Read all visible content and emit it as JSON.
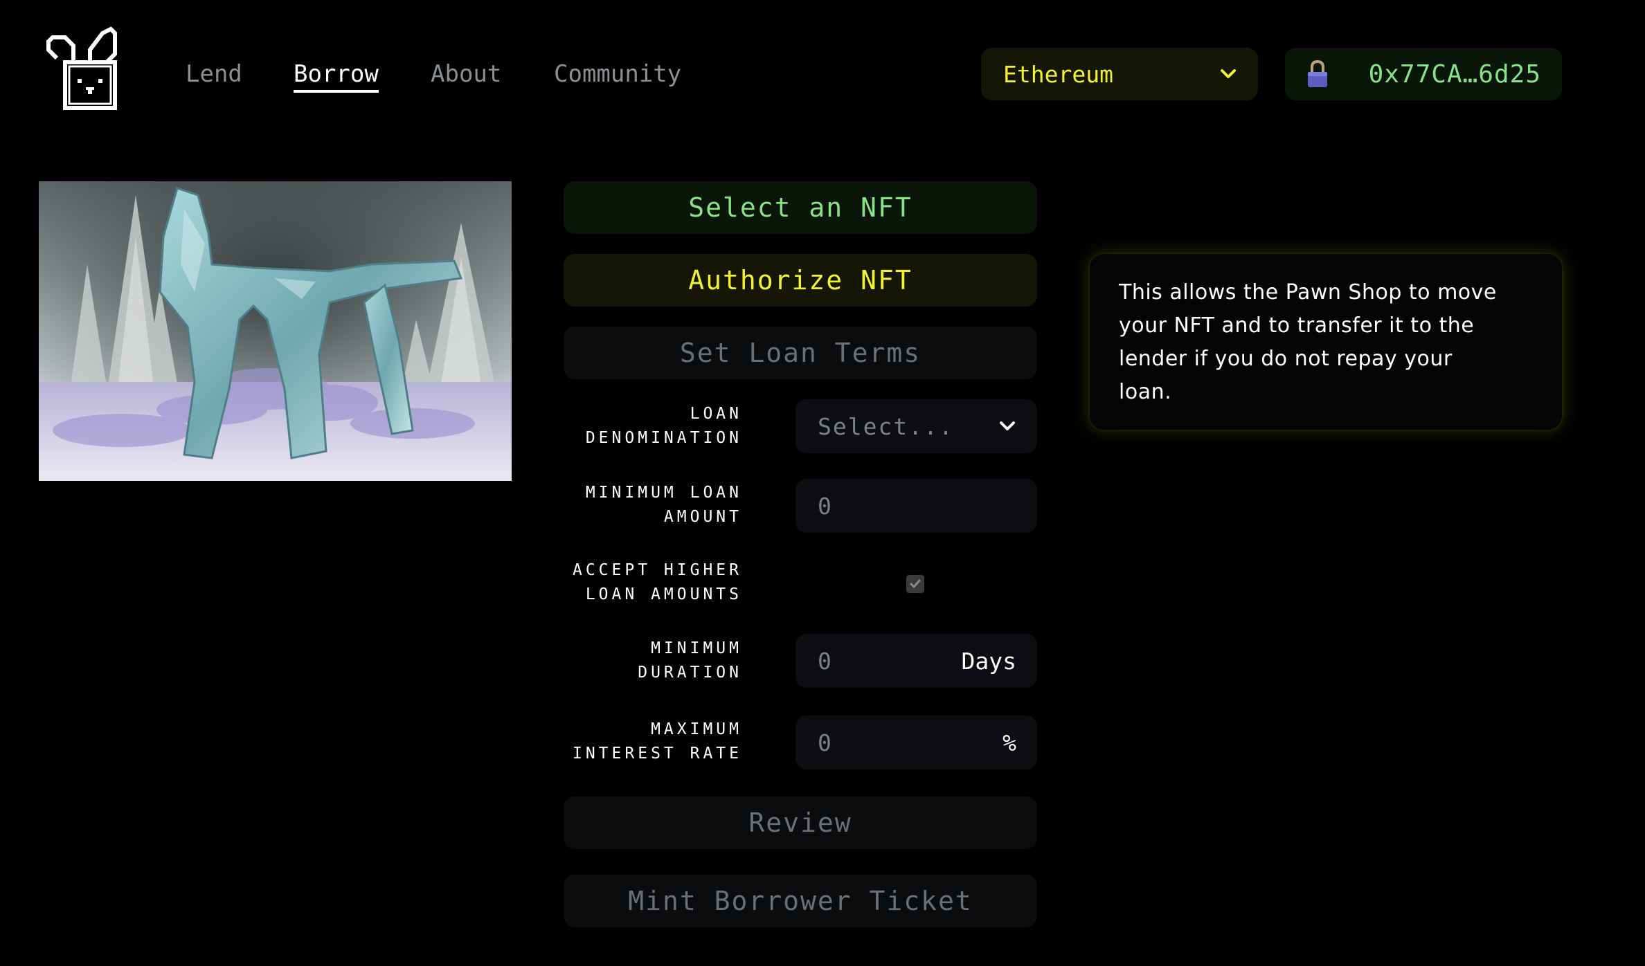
{
  "header": {
    "logo_icon": "rabbit-logo-icon",
    "nav": [
      {
        "label": "Lend",
        "active": false
      },
      {
        "label": "Borrow",
        "active": true
      },
      {
        "label": "About",
        "active": false
      },
      {
        "label": "Community",
        "active": false
      }
    ],
    "network": {
      "label": "Ethereum",
      "icon": "chevron-down-icon"
    },
    "account": {
      "icon": "lock-icon",
      "address": "0x77CA…6d25"
    }
  },
  "nft": {
    "icon": "nft-artwork-image"
  },
  "steps": {
    "select_nft": "Select an NFT",
    "authorize_nft": "Authorize NFT",
    "set_loan_terms": "Set Loan Terms",
    "review": "Review",
    "mint_ticket": "Mint Borrower Ticket"
  },
  "form": {
    "loan_denomination": {
      "label": "LOAN\nDENOMINATION",
      "placeholder": "Select..."
    },
    "minimum_loan_amount": {
      "label": "MINIMUM LOAN\nAMOUNT",
      "value": "0"
    },
    "accept_higher": {
      "label": "ACCEPT HIGHER\nLOAN AMOUNTS",
      "checked": true
    },
    "minimum_duration": {
      "label": "MINIMUM\nDURATION",
      "value": "0",
      "unit": "Days"
    },
    "maximum_interest_rate": {
      "label": "MAXIMUM\nINTEREST RATE",
      "value": "0",
      "unit": "%"
    }
  },
  "info_card": {
    "lines": [
      "This allows the Pawn Shop to move",
      "your NFT and to transfer it to the",
      "lender if you do not repay your",
      "loan."
    ]
  },
  "colors": {
    "background": "#000000",
    "accent_green": "#86e386",
    "accent_yellow": "#f4f32c",
    "muted_text": "#6a7077",
    "nav_inactive": "#8a8f94"
  }
}
